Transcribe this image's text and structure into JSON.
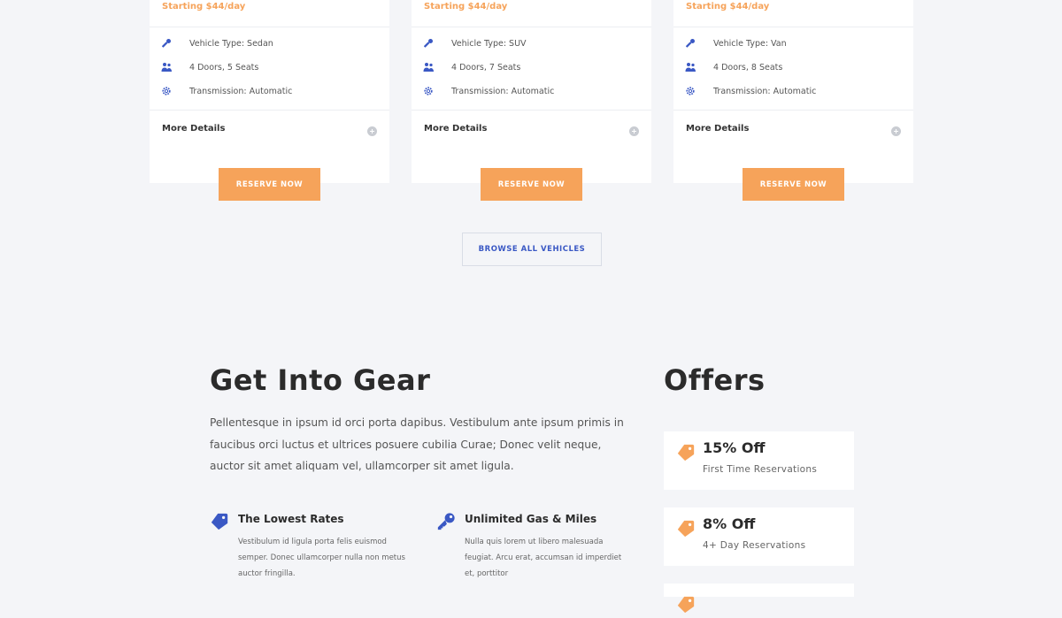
{
  "colors": {
    "accent": "#f6a35a",
    "brand_blue": "#3a58c4",
    "page_background": "#f4f5f8",
    "card_background": "#ffffff"
  },
  "vehicles": [
    {
      "price": "Starting $44/day",
      "specs": [
        {
          "icon": "key-icon",
          "text": "Vehicle Type: Sedan"
        },
        {
          "icon": "people-icon",
          "text": "4 Doors, 5 Seats"
        },
        {
          "icon": "gear-icon",
          "text": "Transmission: Automatic"
        }
      ],
      "more_details": "More Details",
      "reserve_label": "RESERVE NOW"
    },
    {
      "price": "Starting $44/day",
      "specs": [
        {
          "icon": "key-icon",
          "text": "Vehicle Type: SUV"
        },
        {
          "icon": "people-icon",
          "text": "4 Doors, 7 Seats"
        },
        {
          "icon": "gear-icon",
          "text": "Transmission: Automatic"
        }
      ],
      "more_details": "More Details",
      "reserve_label": "RESERVE NOW"
    },
    {
      "price": "Starting $44/day",
      "specs": [
        {
          "icon": "key-icon",
          "text": "Vehicle Type: Van"
        },
        {
          "icon": "people-icon",
          "text": "4 Doors, 8 Seats"
        },
        {
          "icon": "gear-icon",
          "text": "Transmission: Automatic"
        }
      ],
      "more_details": "More Details",
      "reserve_label": "RESERVE NOW"
    }
  ],
  "browse": {
    "label": "BROWSE ALL VEHICLES"
  },
  "gear": {
    "heading": "Get Into Gear",
    "body": "Pellentesque in ipsum id orci porta dapibus. Vestibulum ante ipsum primis in faucibus orci luctus et ultrices posuere cubilia Curae; Donec velit neque, auctor sit amet aliquam vel, ullamcorper sit amet ligula.",
    "features": [
      {
        "icon": "tag-icon",
        "title": "The Lowest Rates",
        "text": "Vestibulum id ligula porta felis euismod semper. Donec ullamcorper nulla non metus auctor fringilla."
      },
      {
        "icon": "key-icon",
        "title": "Unlimited Gas & Miles",
        "text": "Nulla quis lorem ut libero malesuada feugiat. Arcu erat, accumsan id imperdiet et, porttitor"
      }
    ]
  },
  "offers": {
    "heading": "Offers",
    "items": [
      {
        "icon": "tag-icon",
        "amount": "15% Off",
        "description": "First Time Reservations"
      },
      {
        "icon": "tag-icon",
        "amount": "8% Off",
        "description": "4+ Day Reservations"
      }
    ]
  }
}
